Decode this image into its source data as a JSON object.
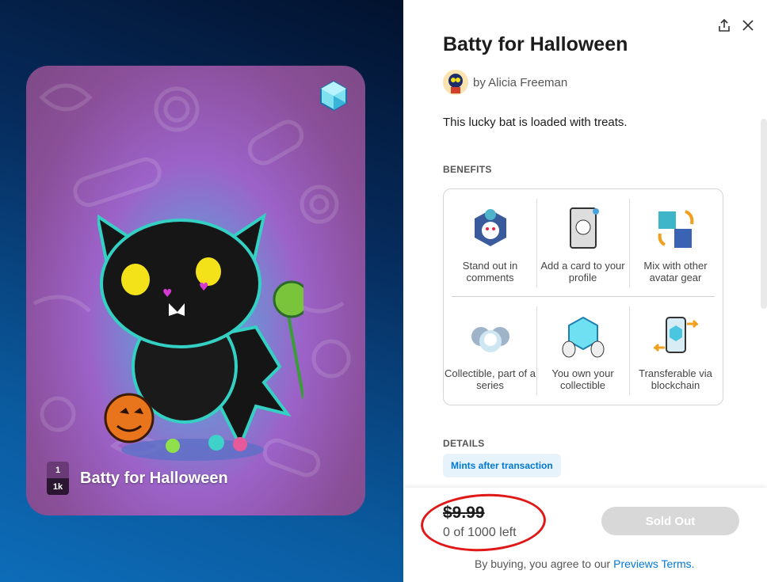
{
  "card": {
    "title": "Batty for Halloween",
    "edition_number": "1",
    "edition_total": "1k"
  },
  "header": {
    "share_icon": "share-icon",
    "close_icon": "close-icon"
  },
  "product": {
    "title": "Batty for Halloween",
    "author": "by Alicia Freeman",
    "description": "This lucky bat is loaded with treats."
  },
  "benefits": {
    "label": "BENEFITS",
    "items": [
      {
        "label": "Stand out in comments",
        "icon": "snoo-hexagon-icon"
      },
      {
        "label": "Add a card to your profile",
        "icon": "profile-card-icon"
      },
      {
        "label": "Mix with other avatar gear",
        "icon": "avatar-gear-icon"
      },
      {
        "label": "Collectible, part of a series",
        "icon": "series-icon"
      },
      {
        "label": "You own your collectible",
        "icon": "crystal-hands-icon"
      },
      {
        "label": "Transferable via blockchain",
        "icon": "transfer-phone-icon"
      }
    ]
  },
  "details": {
    "label": "DETAILS",
    "pill": "Mints after transaction"
  },
  "purchase": {
    "price": "$9.99",
    "remaining": "0 of 1000 left",
    "button_label": "Sold Out",
    "terms_prefix": "By buying, you agree to our ",
    "terms_link": "Previews Terms."
  },
  "colors": {
    "accent": "#0079d3",
    "annotation": "#e01818",
    "disabled_button": "#d8d8d8"
  }
}
